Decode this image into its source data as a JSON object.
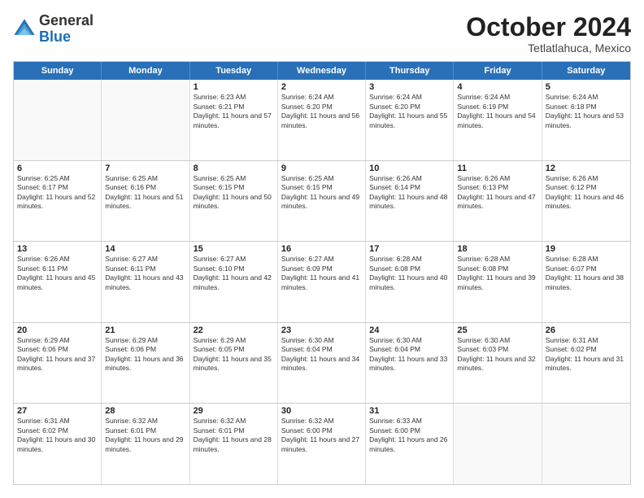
{
  "logo": {
    "general": "General",
    "blue": "Blue"
  },
  "title": "October 2024",
  "subtitle": "Tetlatlahuca, Mexico",
  "days": [
    "Sunday",
    "Monday",
    "Tuesday",
    "Wednesday",
    "Thursday",
    "Friday",
    "Saturday"
  ],
  "rows": [
    [
      {
        "day": "",
        "info": ""
      },
      {
        "day": "",
        "info": ""
      },
      {
        "day": "1",
        "info": "Sunrise: 6:23 AM\nSunset: 6:21 PM\nDaylight: 11 hours and 57 minutes."
      },
      {
        "day": "2",
        "info": "Sunrise: 6:24 AM\nSunset: 6:20 PM\nDaylight: 11 hours and 56 minutes."
      },
      {
        "day": "3",
        "info": "Sunrise: 6:24 AM\nSunset: 6:20 PM\nDaylight: 11 hours and 55 minutes."
      },
      {
        "day": "4",
        "info": "Sunrise: 6:24 AM\nSunset: 6:19 PM\nDaylight: 11 hours and 54 minutes."
      },
      {
        "day": "5",
        "info": "Sunrise: 6:24 AM\nSunset: 6:18 PM\nDaylight: 11 hours and 53 minutes."
      }
    ],
    [
      {
        "day": "6",
        "info": "Sunrise: 6:25 AM\nSunset: 6:17 PM\nDaylight: 11 hours and 52 minutes."
      },
      {
        "day": "7",
        "info": "Sunrise: 6:25 AM\nSunset: 6:16 PM\nDaylight: 11 hours and 51 minutes."
      },
      {
        "day": "8",
        "info": "Sunrise: 6:25 AM\nSunset: 6:15 PM\nDaylight: 11 hours and 50 minutes."
      },
      {
        "day": "9",
        "info": "Sunrise: 6:25 AM\nSunset: 6:15 PM\nDaylight: 11 hours and 49 minutes."
      },
      {
        "day": "10",
        "info": "Sunrise: 6:26 AM\nSunset: 6:14 PM\nDaylight: 11 hours and 48 minutes."
      },
      {
        "day": "11",
        "info": "Sunrise: 6:26 AM\nSunset: 6:13 PM\nDaylight: 11 hours and 47 minutes."
      },
      {
        "day": "12",
        "info": "Sunrise: 6:26 AM\nSunset: 6:12 PM\nDaylight: 11 hours and 46 minutes."
      }
    ],
    [
      {
        "day": "13",
        "info": "Sunrise: 6:26 AM\nSunset: 6:11 PM\nDaylight: 11 hours and 45 minutes."
      },
      {
        "day": "14",
        "info": "Sunrise: 6:27 AM\nSunset: 6:11 PM\nDaylight: 11 hours and 43 minutes."
      },
      {
        "day": "15",
        "info": "Sunrise: 6:27 AM\nSunset: 6:10 PM\nDaylight: 11 hours and 42 minutes."
      },
      {
        "day": "16",
        "info": "Sunrise: 6:27 AM\nSunset: 6:09 PM\nDaylight: 11 hours and 41 minutes."
      },
      {
        "day": "17",
        "info": "Sunrise: 6:28 AM\nSunset: 6:08 PM\nDaylight: 11 hours and 40 minutes."
      },
      {
        "day": "18",
        "info": "Sunrise: 6:28 AM\nSunset: 6:08 PM\nDaylight: 11 hours and 39 minutes."
      },
      {
        "day": "19",
        "info": "Sunrise: 6:28 AM\nSunset: 6:07 PM\nDaylight: 11 hours and 38 minutes."
      }
    ],
    [
      {
        "day": "20",
        "info": "Sunrise: 6:29 AM\nSunset: 6:06 PM\nDaylight: 11 hours and 37 minutes."
      },
      {
        "day": "21",
        "info": "Sunrise: 6:29 AM\nSunset: 6:06 PM\nDaylight: 11 hours and 36 minutes."
      },
      {
        "day": "22",
        "info": "Sunrise: 6:29 AM\nSunset: 6:05 PM\nDaylight: 11 hours and 35 minutes."
      },
      {
        "day": "23",
        "info": "Sunrise: 6:30 AM\nSunset: 6:04 PM\nDaylight: 11 hours and 34 minutes."
      },
      {
        "day": "24",
        "info": "Sunrise: 6:30 AM\nSunset: 6:04 PM\nDaylight: 11 hours and 33 minutes."
      },
      {
        "day": "25",
        "info": "Sunrise: 6:30 AM\nSunset: 6:03 PM\nDaylight: 11 hours and 32 minutes."
      },
      {
        "day": "26",
        "info": "Sunrise: 6:31 AM\nSunset: 6:02 PM\nDaylight: 11 hours and 31 minutes."
      }
    ],
    [
      {
        "day": "27",
        "info": "Sunrise: 6:31 AM\nSunset: 6:02 PM\nDaylight: 11 hours and 30 minutes."
      },
      {
        "day": "28",
        "info": "Sunrise: 6:32 AM\nSunset: 6:01 PM\nDaylight: 11 hours and 29 minutes."
      },
      {
        "day": "29",
        "info": "Sunrise: 6:32 AM\nSunset: 6:01 PM\nDaylight: 11 hours and 28 minutes."
      },
      {
        "day": "30",
        "info": "Sunrise: 6:32 AM\nSunset: 6:00 PM\nDaylight: 11 hours and 27 minutes."
      },
      {
        "day": "31",
        "info": "Sunrise: 6:33 AM\nSunset: 6:00 PM\nDaylight: 11 hours and 26 minutes."
      },
      {
        "day": "",
        "info": ""
      },
      {
        "day": "",
        "info": ""
      }
    ]
  ]
}
